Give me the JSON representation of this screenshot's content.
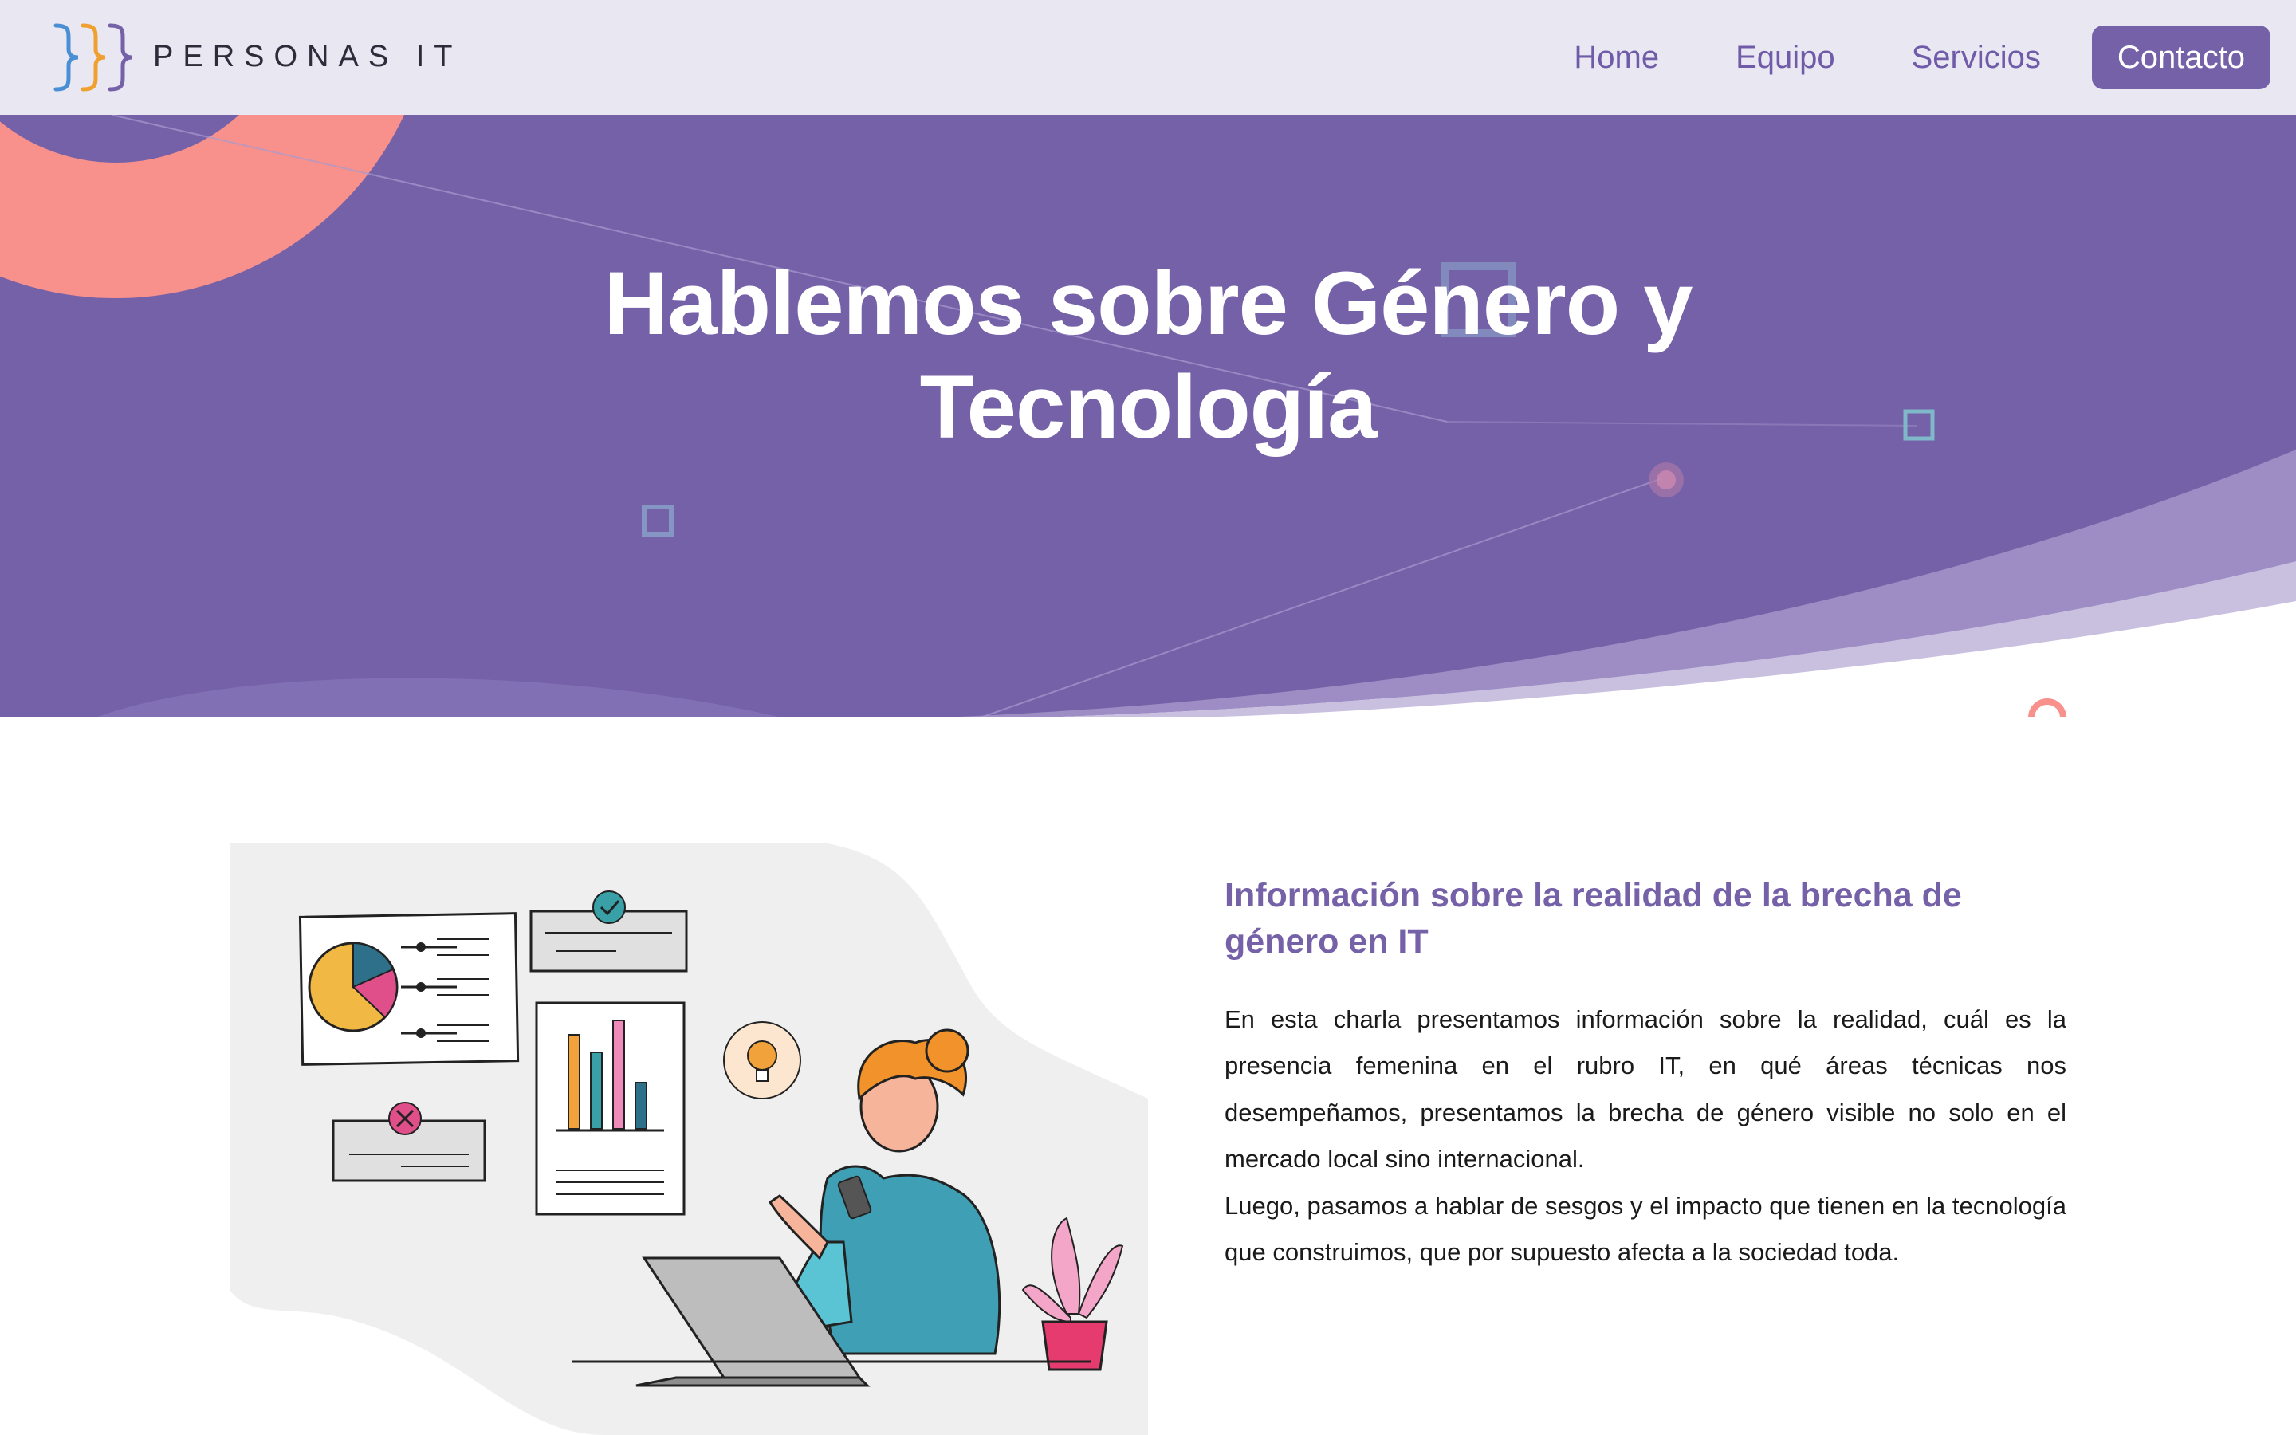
{
  "brand": {
    "name": "PERSONAS IT",
    "colors": {
      "primary": "#7561a8",
      "accent_blue": "#4a8fd4",
      "accent_orange": "#f0a030",
      "coral": "#f8908c",
      "nav_bg": "#e9e7f2"
    }
  },
  "nav": {
    "items": [
      {
        "label": "Home"
      },
      {
        "label": "Equipo"
      },
      {
        "label": "Servicios"
      }
    ],
    "cta_label": "Contacto"
  },
  "hero": {
    "title": "Hablemos sobre Género y Tecnología"
  },
  "section": {
    "heading": "Información sobre la realidad de la brecha de género en IT",
    "paragraphs": [
      "En esta charla presentamos información sobre la realidad, cuál es la presencia femenina en el rubro IT, en qué áreas técnicas nos desempeñamos, presentamos la brecha de género visible no solo en el mercado local sino internacional.",
      "Luego, pasamos a hablar de sesgos y el impacto que tienen en la tecnología que construimos, que por supuesto afecta a la sociedad toda."
    ]
  }
}
